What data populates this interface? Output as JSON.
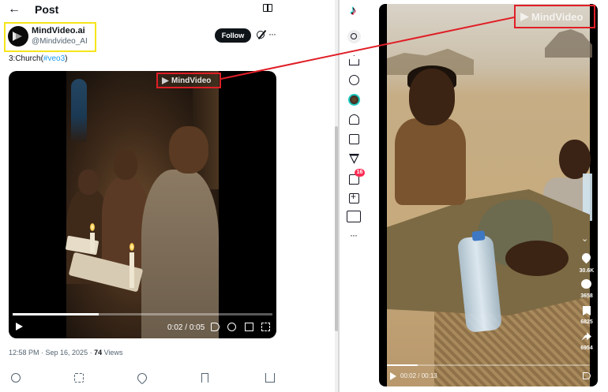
{
  "post_page": {
    "title": "Post",
    "author": {
      "name": "MindVideo.ai",
      "handle": "@Mindvideo_AI"
    },
    "follow_label": "Follow",
    "post_text_prefix": "3:Church(",
    "post_hashtag": "#veo3",
    "post_text_suffix": ")",
    "video": {
      "watermark": "MindVideo",
      "time_current": "0:02",
      "time_total": "0:05",
      "progress": 0.33
    },
    "meta": {
      "time": "12:58 PM · Sep 16, 2025 · ",
      "views_count": "74",
      "views_label": " Views"
    }
  },
  "tiktok": {
    "inbox_badge": "16",
    "video": {
      "watermark": "MindVideo",
      "likes": "30.6K",
      "comments": "3658",
      "bookmarks": "6825",
      "shares": "6954",
      "time_current": "00:02",
      "time_total": "00:13",
      "progress": 0.15
    }
  },
  "colors": {
    "highlight_yellow": "#f5e51b",
    "highlight_red": "#e01e26",
    "link_blue": "#1d9bf0"
  }
}
